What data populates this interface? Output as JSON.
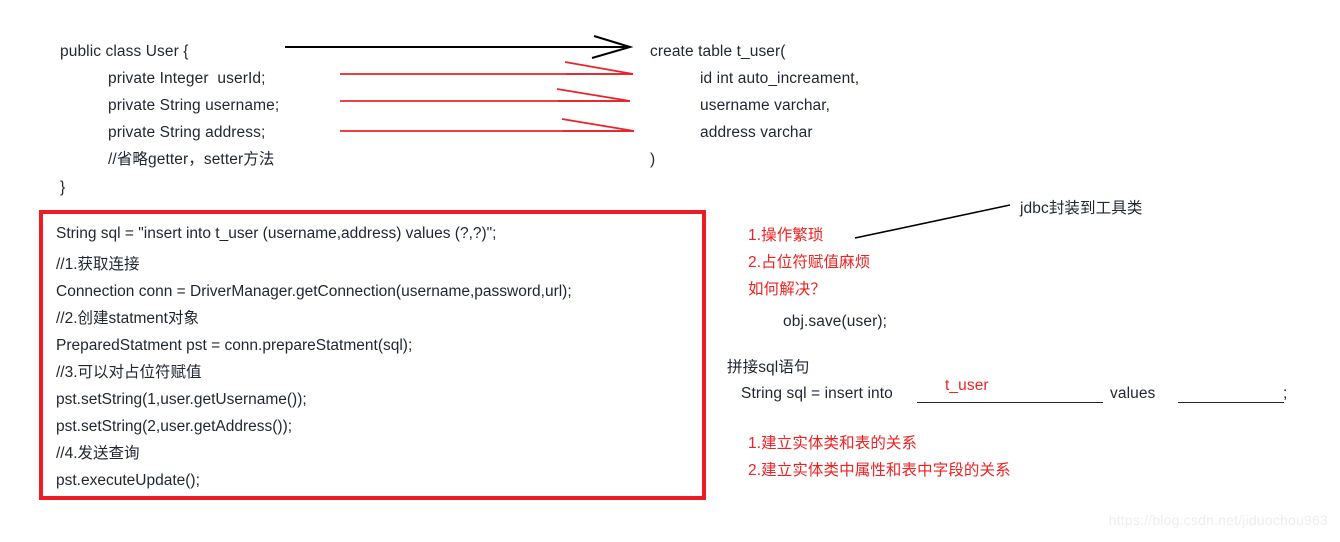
{
  "diagram": {
    "title_watermark": "https://blog.csdn.net/jiduochou963",
    "accent_red": "#ed1c24",
    "text_color": "#1f2533"
  },
  "entity_class": {
    "lines": [
      "public class User {",
      "private Integer  userId;",
      "private String username;",
      "private String address;",
      "//省略getter，setter方法",
      "}"
    ]
  },
  "sql_table": {
    "lines": [
      "create table t_user(",
      "id int auto_increament,",
      "username varchar,",
      "address varchar",
      ")"
    ]
  },
  "jdbc_code": {
    "lines": [
      "String sql = \"insert into t_user (username,address) values (?,?)\";",
      "//1.获取连接",
      "Connection conn = DriverManager.getConnection(username,password,url);",
      "//2.创建statment对象",
      "PreparedStatment pst = conn.prepareStatment(sql);",
      "//3.可以对占位符赋值",
      "pst.setString(1,user.getUsername());",
      "pst.setString(2,user.getAddress());",
      "//4.发送查询",
      "pst.executeUpdate();"
    ]
  },
  "problems": {
    "item1": "1.操作繁琐",
    "item2": "2.占位符赋值麻烦",
    "question": "如何解决？",
    "solution_call": "obj.save(user);",
    "callout": "jdbc封装到工具类"
  },
  "sql_concat": {
    "heading": "拼接sql语句",
    "prefix": "String sql = insert into",
    "blank1_value": "t_user",
    "middle": "values",
    "suffix": ";"
  },
  "mapping_notes": {
    "note1": "1.建立实体类和表的关系",
    "note2": "2.建立实体类中属性和表中字段的关系"
  }
}
